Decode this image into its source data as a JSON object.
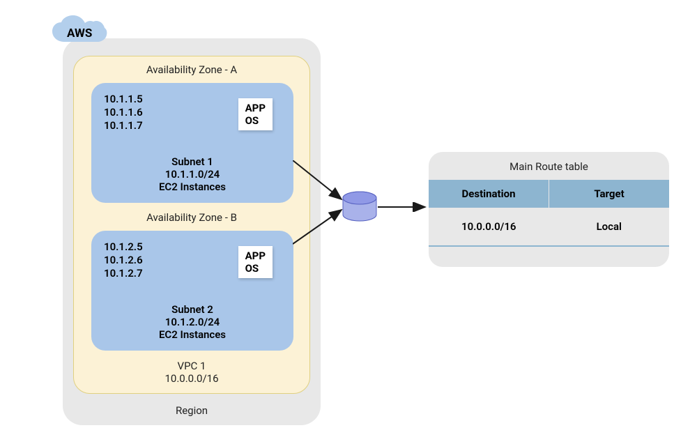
{
  "aws": {
    "label": "AWS"
  },
  "region": {
    "label": "Region"
  },
  "vpc": {
    "name": "VPC 1",
    "cidr": "10.0.0.0/16"
  },
  "azA": {
    "label": "Availability Zone - A"
  },
  "azB": {
    "label": "Availability Zone - B"
  },
  "subnet1": {
    "ips": [
      "10.1.1.5",
      "10.1.1.6",
      "10.1.1.7"
    ],
    "app_os_line1": "APP",
    "app_os_line2": "OS",
    "name": "Subnet 1",
    "cidr": "10.1.1.0/24",
    "instances": "EC2 Instances"
  },
  "subnet2": {
    "ips": [
      "10.1.2.5",
      "10.1.2.6",
      "10.1.2.7"
    ],
    "app_os_line1": "APP",
    "app_os_line2": "OS",
    "name": "Subnet 2",
    "cidr": "10.1.2.0/24",
    "instances": "EC2 Instances"
  },
  "routeTable": {
    "title": "Main Route table",
    "headers": {
      "destination": "Destination",
      "target": "Target"
    },
    "rows": [
      {
        "destination": "10.0.0.0/16",
        "target": "Local"
      }
    ]
  }
}
